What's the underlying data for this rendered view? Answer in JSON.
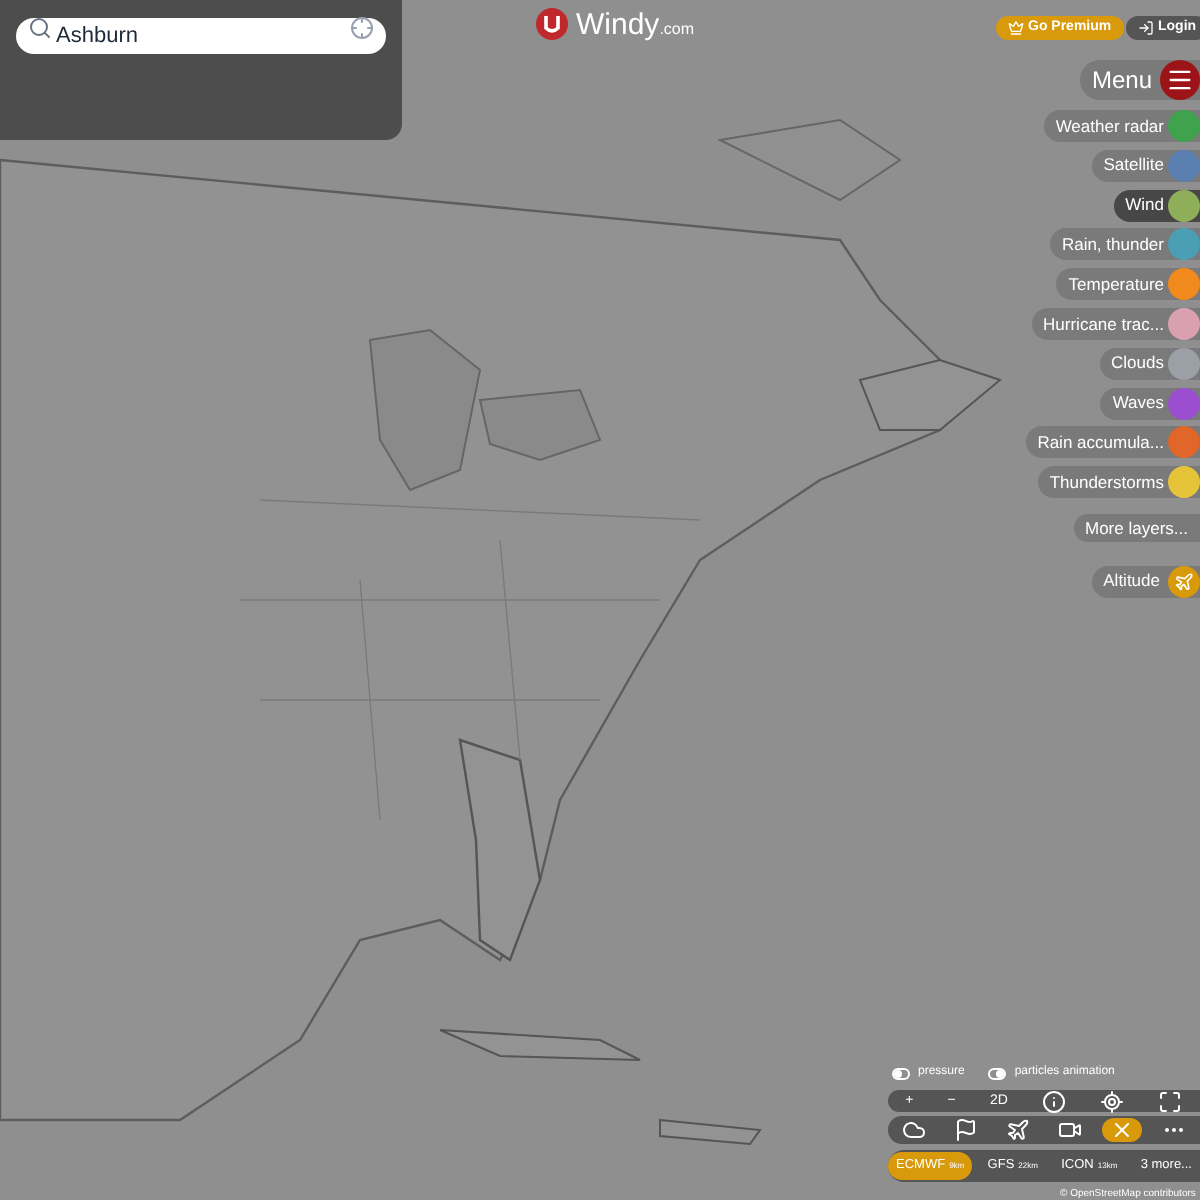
{
  "search": {
    "value": "Ashburn"
  },
  "logo": {
    "text": "Windy",
    "suffix": ".com"
  },
  "header": {
    "premium": "Go Premium",
    "login": "Login"
  },
  "menu": {
    "label": "Menu"
  },
  "layers": [
    {
      "label": "Weather radar",
      "selected": false,
      "color": "#3fa34d"
    },
    {
      "label": "Satellite",
      "selected": false,
      "color": "#5a7fb0"
    },
    {
      "label": "Wind",
      "selected": true,
      "color": "#8fae5a"
    },
    {
      "label": "Rain, thunder",
      "selected": false,
      "color": "#4a9fb5"
    },
    {
      "label": "Temperature",
      "selected": false,
      "color": "#f08a1c"
    },
    {
      "label": "Hurricane trac...",
      "selected": false,
      "color": "#d9a0b0"
    },
    {
      "label": "Clouds",
      "selected": false,
      "color": "#9aa0a6"
    },
    {
      "label": "Waves",
      "selected": false,
      "color": "#9b4fd0"
    },
    {
      "label": "Rain accumula...",
      "selected": false,
      "color": "#e0662a"
    },
    {
      "label": "Thunderstorms",
      "selected": false,
      "color": "#e6c43a"
    }
  ],
  "more_layers": "More layers...",
  "altitude": {
    "label": "Altitude"
  },
  "toggles": [
    {
      "label": "pressure",
      "on": false
    },
    {
      "label": "particles animation",
      "on": true
    }
  ],
  "toolbar": [
    {
      "kind": "text",
      "label": "+"
    },
    {
      "kind": "text",
      "label": "−"
    },
    {
      "kind": "text",
      "label": "2D"
    },
    {
      "kind": "info"
    },
    {
      "kind": "locate"
    },
    {
      "kind": "fullscreen"
    }
  ],
  "tools": [
    {
      "kind": "cloud",
      "selected": false
    },
    {
      "kind": "flag",
      "selected": false
    },
    {
      "kind": "plane",
      "selected": false
    },
    {
      "kind": "camera",
      "selected": false
    },
    {
      "kind": "close",
      "selected": true
    },
    {
      "kind": "dots",
      "selected": false
    }
  ],
  "models": [
    {
      "label": "ECMWF",
      "sub": "9km",
      "selected": true
    },
    {
      "label": "GFS",
      "sub": "22km",
      "selected": false
    },
    {
      "label": "ICON",
      "sub": "13km",
      "selected": false
    },
    {
      "label": "3 more...",
      "selected": false
    }
  ],
  "attribution": "© OpenStreetMap contributors"
}
